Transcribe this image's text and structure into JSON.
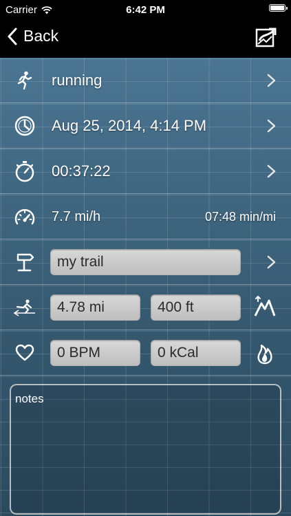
{
  "status_bar": {
    "carrier": "Carrier",
    "time": "6:42 PM"
  },
  "nav": {
    "back_label": "Back"
  },
  "rows": {
    "activity": "running",
    "datetime": "Aug 25, 2014, 4:14 PM",
    "duration": "00:37:22",
    "speed": "7.7 mi/h",
    "pace": "07:48 min/mi",
    "trail": "my trail",
    "distance": "4.78 mi",
    "elevation": "400 ft",
    "heart_rate": "0 BPM",
    "calories": "0 kCal"
  },
  "notes": {
    "label": "notes"
  },
  "icons": {
    "activity": "runner-icon",
    "datetime": "clock-icon",
    "duration": "stopwatch-icon",
    "speed": "speedometer-icon",
    "trail": "trail-sign-icon",
    "distance": "distance-icon",
    "elevation": "mountain-icon",
    "heart_rate": "heart-icon",
    "calories": "flame-icon",
    "share": "share-icon"
  },
  "colors": {
    "background": "#3f6580",
    "field": "#d0d0d0",
    "bar": "#000000"
  }
}
